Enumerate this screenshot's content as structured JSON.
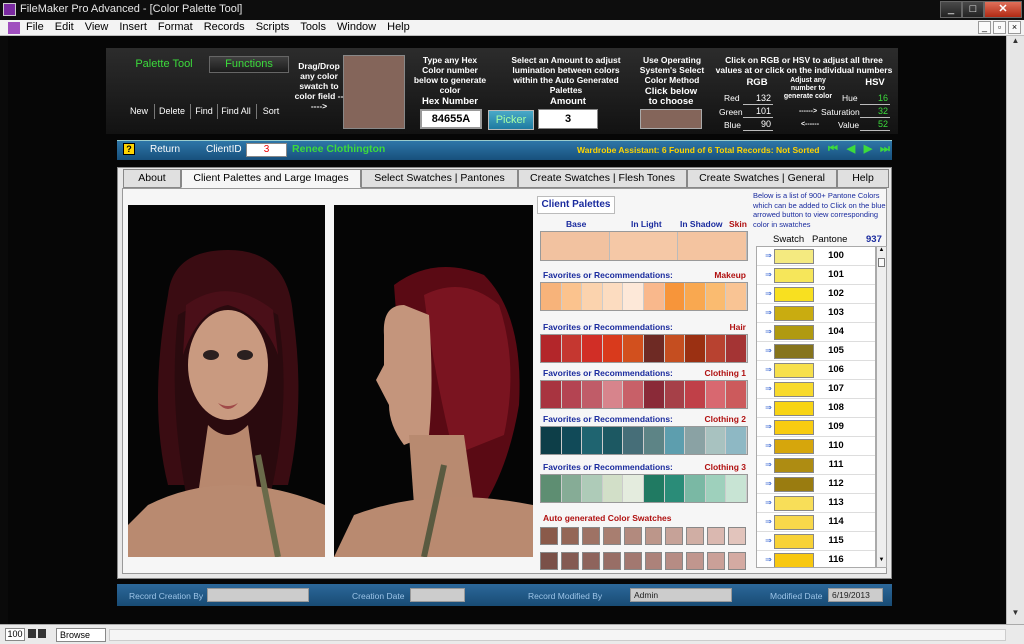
{
  "window": {
    "title": "FileMaker Pro Advanced - [Color Palette Tool]",
    "min_glyph": "_",
    "max_glyph": "□",
    "close_glyph": "✕"
  },
  "menu": {
    "items": [
      "File",
      "Edit",
      "View",
      "Insert",
      "Format",
      "Records",
      "Scripts",
      "Tools",
      "Window",
      "Help"
    ],
    "mdi": [
      "_",
      "▫",
      "×"
    ]
  },
  "toolpanel": {
    "palette_tool": "Palette Tool",
    "functions": "Functions",
    "buttons": [
      "New",
      "Delete",
      "Find",
      "Find All",
      "Sort"
    ],
    "dragdrop": "Drag/Drop any color swatch to color field ------>",
    "hex_instruction": "Type any Hex Color number below to generate color",
    "hex_label": "Hex Number",
    "hex_value": "84655A",
    "picker": "Picker",
    "amount_instruction": "Select an Amount to adjust lumination between colors within the Auto Generated Palettes",
    "amount_label": "Amount",
    "amount_value": "3",
    "os_instruction": "Use Operating System's Select Color Method",
    "click_below": "Click below to choose",
    "rgbhsv_instruction": "Click on RGB or HSV to adjust all three values at or click on the individual numbers",
    "rgb_label": "RGB",
    "hsv_label": "HSV",
    "adjust_note": "Adjust any number to generate color",
    "arrow_right": "------>",
    "arrow_left": "<------",
    "red_label": "Red",
    "red": "132",
    "green_label": "Green",
    "green": "101",
    "blue_label": "Blue",
    "blue": "90",
    "hue_label": "Hue",
    "hue": "16",
    "sat_label": "Saturation",
    "sat": "32",
    "val_label": "Value",
    "val": "52",
    "swatch_color": "#84655a"
  },
  "nav": {
    "help": "?",
    "return": "Return",
    "clientid_label": "ClientID",
    "clientid": "3",
    "client_name": "Renee Clothington",
    "status": "Wardrobe Assistant:  6 Found of 6 Total Records: Not Sorted",
    "arrows": [
      "⏮",
      "◀",
      "▶",
      "⏭"
    ]
  },
  "tabs": [
    "About",
    "Client Palettes and Large Images",
    "Select Swatches | Pantones",
    "Create Swatches | Flesh Tones",
    "Create Swatches | General",
    "Help"
  ],
  "palettes": {
    "title": "Client Palettes",
    "col_base": "Base",
    "col_light": "In Light",
    "col_shadow": "In Shadow",
    "col_skin": "Skin",
    "skin_colors": [
      "#f2c2a0",
      "#f5c8a6",
      "#f4c4a0"
    ],
    "fav_label": "Favorites or Recommendations:",
    "rows": [
      {
        "cat": "Makeup",
        "colors": [
          "#f7b37a",
          "#fbc38e",
          "#fbd3ae",
          "#fcdcc0",
          "#fde8d8",
          "#f9b88c",
          "#f7953a",
          "#f9a850",
          "#fabb70",
          "#f9c494"
        ]
      },
      {
        "cat": "Hair",
        "colors": [
          "#b3262a",
          "#c53730",
          "#d12e26",
          "#d93a1c",
          "#d2501e",
          "#6e2a24",
          "#c54e20",
          "#9b3012",
          "#b84230",
          "#a43434"
        ]
      },
      {
        "cat": "Clothing 1",
        "colors": [
          "#a83440",
          "#b44452",
          "#c05c68",
          "#d7848c",
          "#c86068",
          "#8a2a38",
          "#a64048",
          "#c04048",
          "#d86870",
          "#cc5a5c"
        ]
      },
      {
        "cat": "Clothing 2",
        "colors": [
          "#0d3e48",
          "#114a58",
          "#1f6470",
          "#1c5862",
          "#466e78",
          "#5d8486",
          "#5d9eae",
          "#8aa2a4",
          "#a8c2c0",
          "#8eb8c4"
        ]
      },
      {
        "cat": "Clothing 3",
        "colors": [
          "#5e8e72",
          "#86ac96",
          "#aecbb8",
          "#d2dfc8",
          "#e4ecde",
          "#207a62",
          "#2a8c78",
          "#7ab8a4",
          "#9ed0bc",
          "#c8e4d4"
        ]
      }
    ],
    "auto_label": "Auto generated Color Swatches",
    "auto_row1": [
      "#8a5a4a",
      "#946656",
      "#9e7264",
      "#a87e70",
      "#b28a7e",
      "#bc968a",
      "#c6a298",
      "#d0aea4",
      "#dab8b0",
      "#e2c4bc"
    ],
    "auto_row2": [
      "#7a5048",
      "#845a52",
      "#8e645c",
      "#986e66",
      "#a27870",
      "#ac827a",
      "#b68c84",
      "#c0968e",
      "#caa098",
      "#d4aaa2"
    ]
  },
  "pantone": {
    "note": "Below is a list of 900+ Pantone Colors which can be added to Click on the blue arrowed button to view corresponding color in swatches",
    "swatch_hdr": "Swatch",
    "pantone_hdr": "Pantone",
    "count": "937",
    "arrow": "⇒",
    "items": [
      {
        "num": "100",
        "color": "#f4ea80"
      },
      {
        "num": "101",
        "color": "#f6e65a"
      },
      {
        "num": "102",
        "color": "#f8e020"
      },
      {
        "num": "103",
        "color": "#c9ac10"
      },
      {
        "num": "104",
        "color": "#b09a10"
      },
      {
        "num": "105",
        "color": "#86741c"
      },
      {
        "num": "106",
        "color": "#f7e04c"
      },
      {
        "num": "107",
        "color": "#f8da2c"
      },
      {
        "num": "108",
        "color": "#f8d414"
      },
      {
        "num": "109",
        "color": "#f8cc10"
      },
      {
        "num": "110",
        "color": "#d6a60c"
      },
      {
        "num": "111",
        "color": "#ae8c12"
      },
      {
        "num": "112",
        "color": "#9a7c10"
      },
      {
        "num": "113",
        "color": "#f8de58"
      },
      {
        "num": "114",
        "color": "#f8d84a"
      },
      {
        "num": "115",
        "color": "#f8d236"
      },
      {
        "num": "116",
        "color": "#f8c810"
      }
    ]
  },
  "footer": {
    "created_by": "Record Creation By",
    "creation_date": "Creation Date",
    "modified_by": "Record Modified By",
    "modified_by_value": "Admin",
    "modified_date": "Modified Date",
    "modified_date_value": "6/19/2013"
  },
  "status": {
    "zoom": "100",
    "mode": "Browse"
  }
}
